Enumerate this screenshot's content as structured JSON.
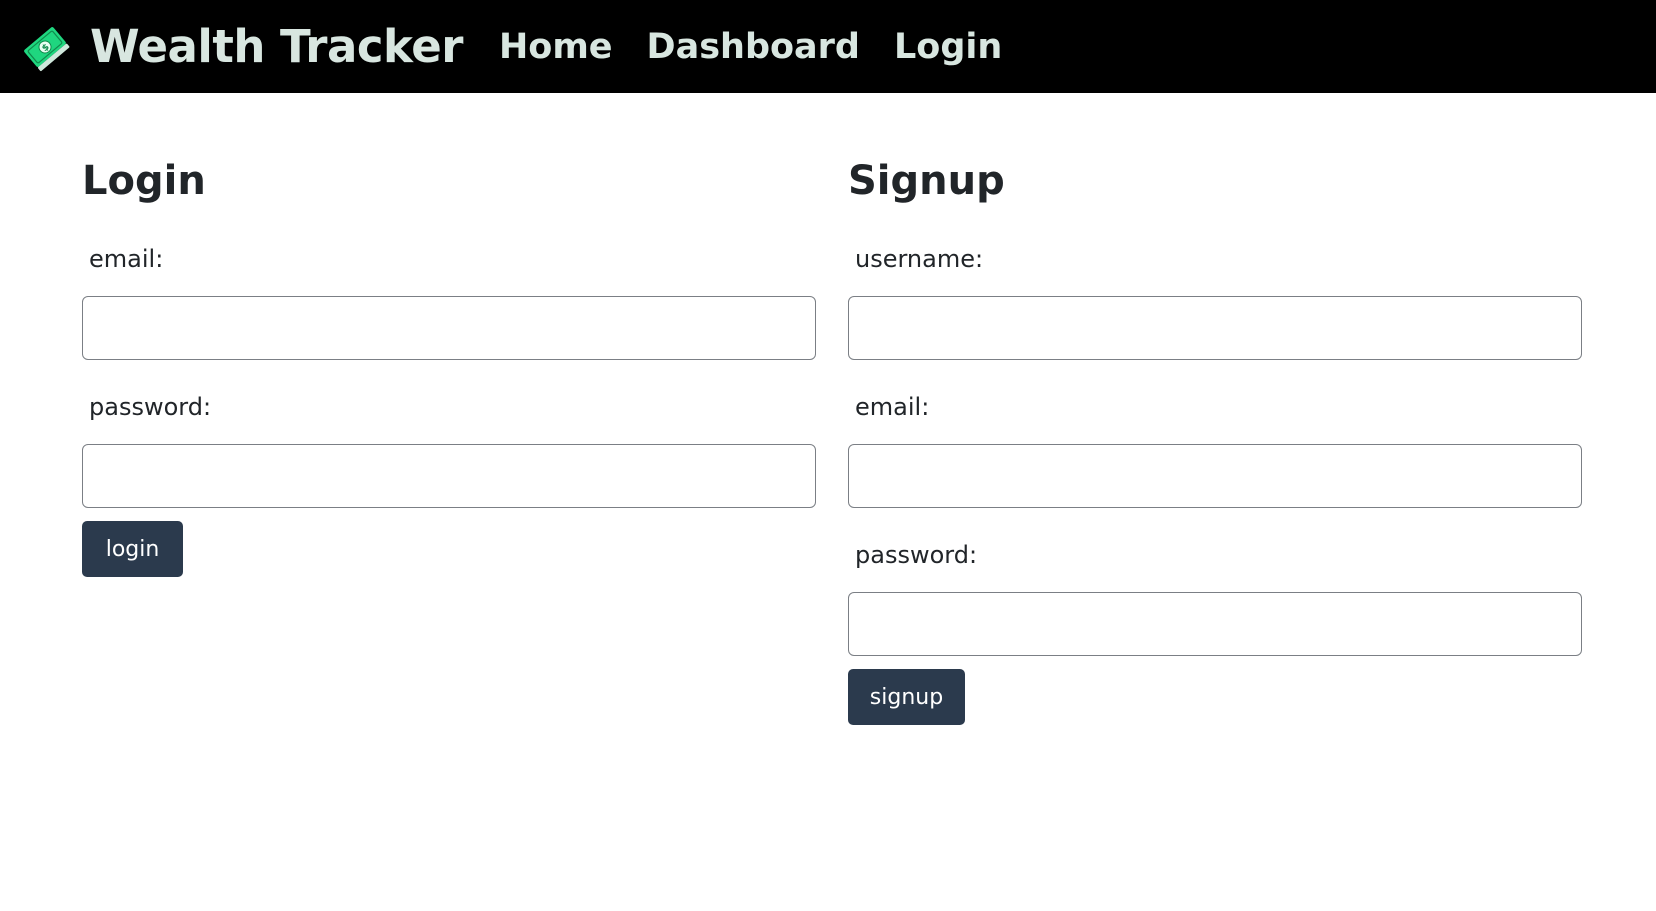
{
  "nav": {
    "brand": "Wealth Tracker",
    "links": [
      "Home",
      "Dashboard",
      "Login"
    ]
  },
  "login": {
    "title": "Login",
    "email_label": "email:",
    "password_label": "password:",
    "button": "login"
  },
  "signup": {
    "title": "Signup",
    "username_label": "username:",
    "email_label": "email:",
    "password_label": "password:",
    "button": "signup"
  },
  "colors": {
    "navbar_bg": "#000000",
    "nav_text": "#d8e6e0",
    "button_bg": "#2b3a4d",
    "logo_green": "#1fd67f"
  },
  "icons": {
    "brand": "money-bill-icon"
  }
}
